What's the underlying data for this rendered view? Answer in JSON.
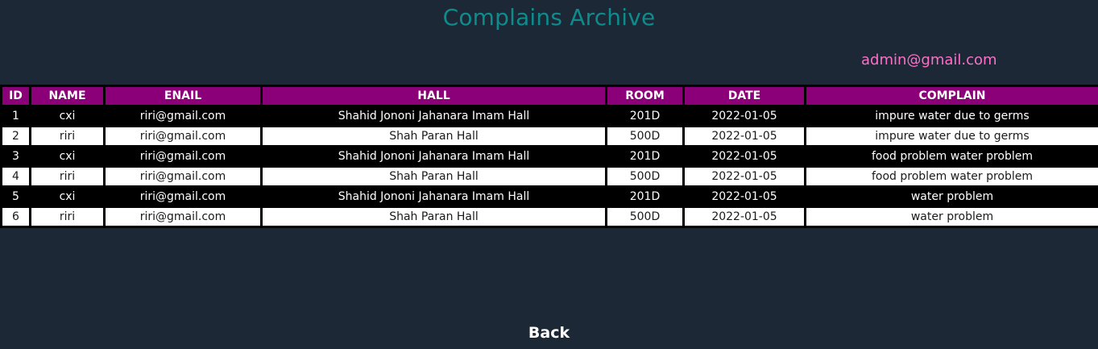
{
  "header": {
    "title": "Complains Archive",
    "user_email": "admin@gmail.com"
  },
  "table": {
    "columns": [
      "ID",
      "NAME",
      "ENAIL",
      "HALL",
      "ROOM",
      "DATE",
      "COMPLAIN"
    ],
    "rows": [
      [
        "1",
        "cxi",
        "riri@gmail.com",
        "Shahid Jononi Jahanara Imam Hall",
        "201D",
        "2022-01-05",
        "impure water due to germs"
      ],
      [
        "2",
        "riri",
        "riri@gmail.com",
        "Shah Paran Hall",
        "500D",
        "2022-01-05",
        "impure water due to germs"
      ],
      [
        "3",
        "cxi",
        "riri@gmail.com",
        "Shahid Jononi Jahanara Imam Hall",
        "201D",
        "2022-01-05",
        "food problem water problem"
      ],
      [
        "4",
        "riri",
        "riri@gmail.com",
        "Shah Paran Hall",
        "500D",
        "2022-01-05",
        "food problem water problem"
      ],
      [
        "5",
        "cxi",
        "riri@gmail.com",
        "Shahid Jononi Jahanara Imam Hall",
        "201D",
        "2022-01-05",
        "water problem"
      ],
      [
        "6",
        "riri",
        "riri@gmail.com",
        "Shah Paran Hall",
        "500D",
        "2022-01-05",
        "water problem"
      ]
    ]
  },
  "footer": {
    "back_label": "Back"
  },
  "colors": {
    "background": "#1c2836",
    "title": "#0e8c8c",
    "email": "#ff6ec7",
    "header_row": "#8b0078"
  }
}
